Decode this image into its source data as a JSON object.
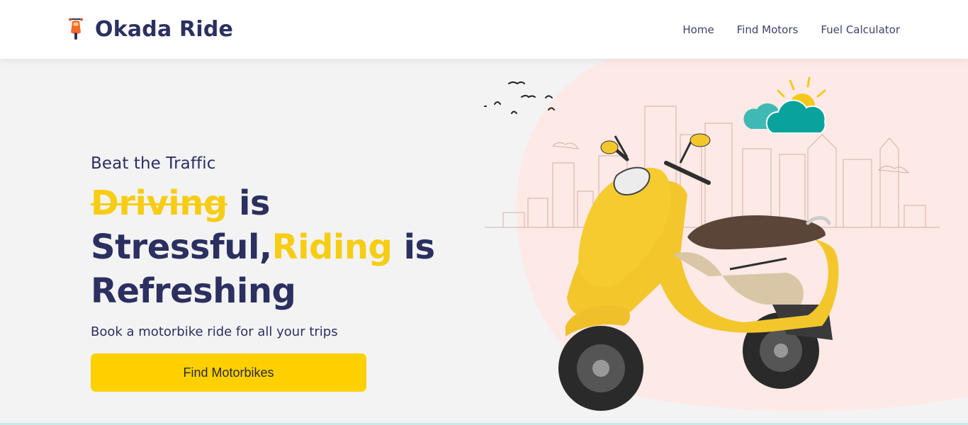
{
  "brand": {
    "name": "Okada Ride",
    "logo_icon": "scooter-icon"
  },
  "nav": {
    "items": [
      {
        "label": "Home"
      },
      {
        "label": "Find Motors"
      },
      {
        "label": "Fuel Calculator"
      }
    ]
  },
  "hero": {
    "eyebrow": "Beat the Traffic",
    "headline": {
      "strike_word": "Driving",
      "part1": " is Stressful,",
      "highlight_word": "Riding",
      "part2": " is Refreshing"
    },
    "subtext": "Book a motorbike ride for all your trips",
    "cta_label": "Find Motorbikes",
    "illustration": "yellow-scooter-city-illustration"
  },
  "colors": {
    "navy": "#2b3060",
    "yellow": "#ffd000",
    "accent_yellow": "#f6cd14",
    "pink_blob": "#fde9e6",
    "background": "#f3f3f4"
  }
}
